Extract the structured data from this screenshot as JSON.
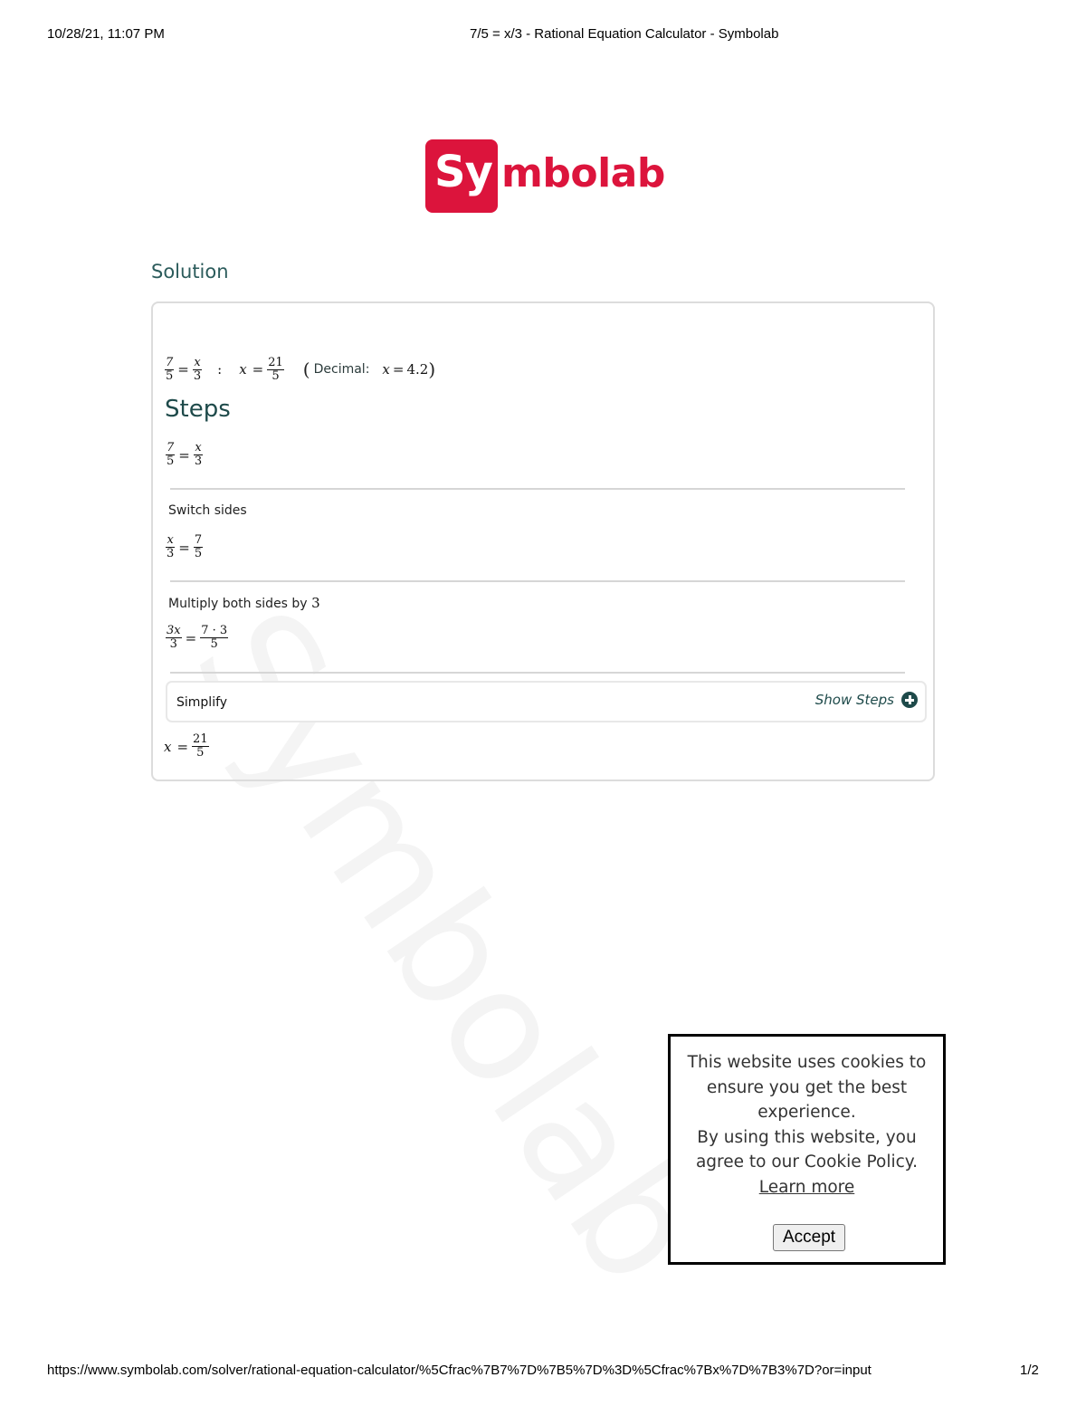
{
  "print_header": {
    "date": "10/28/21, 11:07 PM",
    "title": "7/5 = x/3 - Rational Equation Calculator - Symbolab"
  },
  "print_footer": {
    "url": "https://www.symbolab.com/solver/rational-equation-calculator/%5Cfrac%7B7%7D%7B5%7D%3D%5Cfrac%7Bx%7D%7B3%7D?or=input",
    "page": "1/2"
  },
  "logo": {
    "sy": "Sy",
    "rest": "mbolab",
    "brand_color": "#dc143c"
  },
  "watermark": "Symbolab",
  "solution": {
    "title": "Solution",
    "answer": {
      "lhs": {
        "num": "7",
        "den": "5"
      },
      "rhs": {
        "num": "x",
        "den": "3"
      },
      "separator": ":",
      "result_var": "x",
      "result": {
        "num": "21",
        "den": "5"
      },
      "decimal_label": "Decimal:",
      "decimal_var": "x",
      "decimal_value": "4.2"
    }
  },
  "steps": {
    "title": "Steps",
    "initial": {
      "lhs": {
        "num": "7",
        "den": "5"
      },
      "rhs": {
        "num": "x",
        "den": "3"
      }
    },
    "items": [
      {
        "label": "Switch sides",
        "label_math": "",
        "lhs": {
          "num": "x",
          "den": "3"
        },
        "rhs": {
          "num": "7",
          "den": "5"
        }
      },
      {
        "label": "Multiply both sides by",
        "label_math": "3",
        "lhs": {
          "num": "3x",
          "den": "3"
        },
        "rhs": {
          "num": "7 · 3",
          "den": "5"
        }
      }
    ],
    "simplify": {
      "label": "Simplify",
      "show_steps": "Show Steps",
      "icon": "plus-circle-icon"
    },
    "final": {
      "var": "x",
      "result": {
        "num": "21",
        "den": "5"
      }
    }
  },
  "cookie_banner": {
    "text_lines": [
      "This website uses cookies to",
      "ensure you get the best",
      "experience.",
      "By using this website, you",
      "agree to our Cookie Policy."
    ],
    "learn_more": "Learn more",
    "accept": "Accept"
  },
  "colors": {
    "heading": "#1e4a4a",
    "card_border": "#dcdcdc"
  }
}
